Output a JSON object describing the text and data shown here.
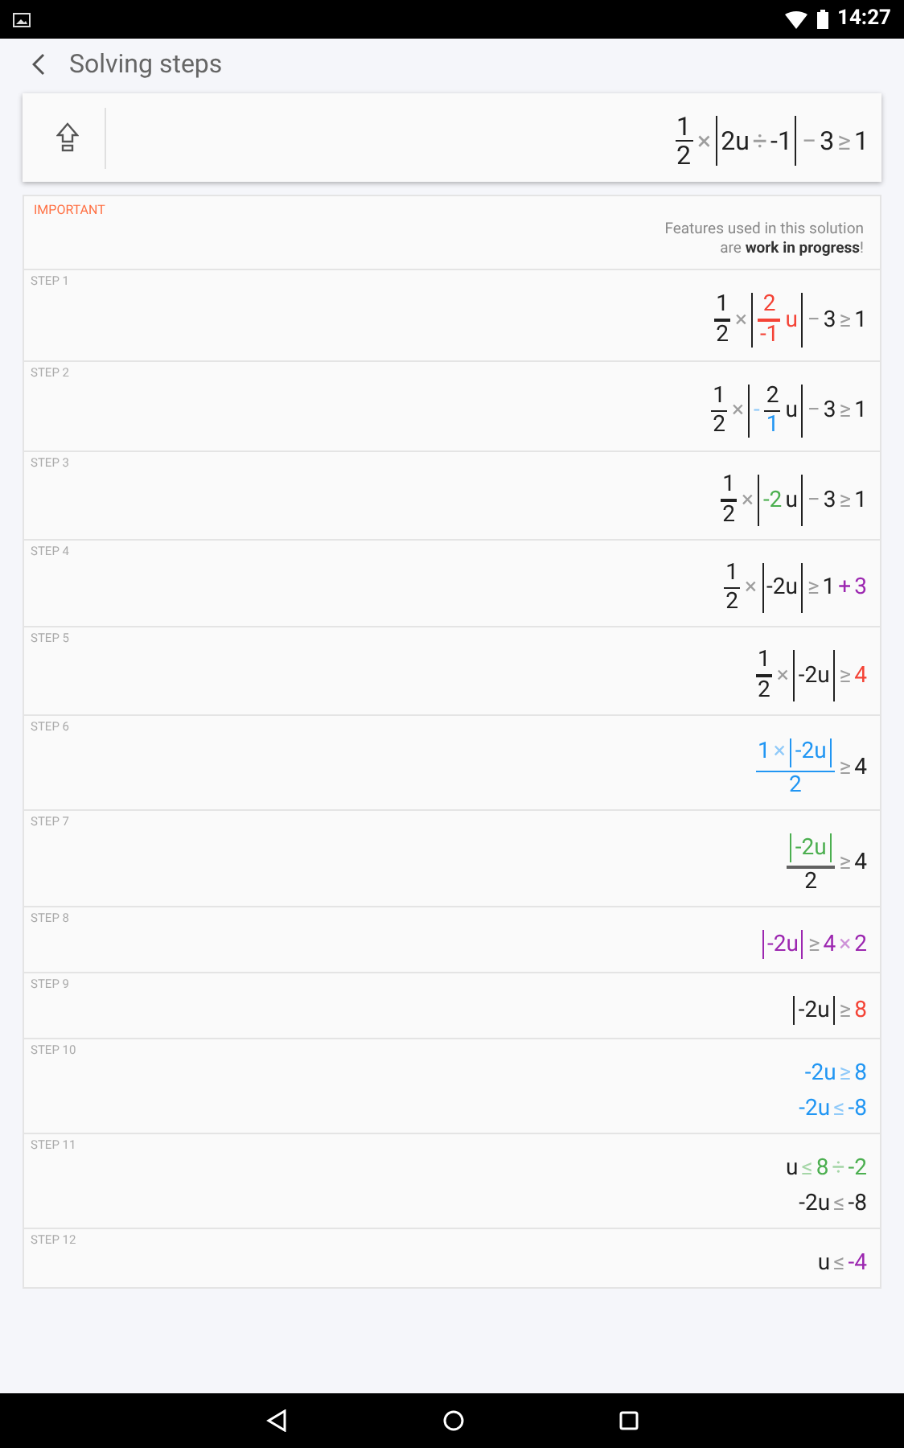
{
  "status_bar": {
    "time": "14:27"
  },
  "header": {
    "title": "Solving steps"
  },
  "input": {
    "expression": [
      {
        "kind": "frac",
        "num": [
          {
            "kind": "t",
            "text": "1",
            "color": "#212121"
          }
        ],
        "den": [
          {
            "kind": "t",
            "text": "2",
            "color": "#212121"
          }
        ],
        "color": "#212121"
      },
      {
        "kind": "t",
        "text": "×",
        "color": "#9e9e9e"
      },
      {
        "kind": "abs",
        "color": "#212121",
        "body": [
          {
            "kind": "t",
            "text": "2u",
            "color": "#212121"
          },
          {
            "kind": "t",
            "text": "÷",
            "color": "#9e9e9e"
          },
          {
            "kind": "t",
            "text": "-1",
            "color": "#212121"
          }
        ]
      },
      {
        "kind": "t",
        "text": "−",
        "color": "#9e9e9e"
      },
      {
        "kind": "t",
        "text": "3",
        "color": "#212121"
      },
      {
        "kind": "t",
        "text": "≥",
        "color": "#9e9e9e"
      },
      {
        "kind": "t",
        "text": "1",
        "color": "#212121"
      }
    ]
  },
  "notice": {
    "label": "IMPORTANT",
    "lines": [
      "Features used in this solution",
      "are **work in progress**!"
    ]
  },
  "steps": [
    {
      "label": "STEP 1",
      "lines": [
        [
          {
            "kind": "frac",
            "num": [
              {
                "kind": "t",
                "text": "1",
                "color": "#212121"
              }
            ],
            "den": [
              {
                "kind": "t",
                "text": "2",
                "color": "#212121"
              }
            ],
            "color": "#212121"
          },
          {
            "kind": "t",
            "text": "×",
            "color": "#9e9e9e"
          },
          {
            "kind": "abs",
            "color": "#212121",
            "body": [
              {
                "kind": "frac",
                "num": [
                  {
                    "kind": "t",
                    "text": "2",
                    "color": "#f44336"
                  }
                ],
                "den": [
                  {
                    "kind": "t",
                    "text": "-1",
                    "color": "#f44336"
                  }
                ],
                "color": "#f44336"
              },
              {
                "kind": "t",
                "text": "u",
                "color": "#f44336"
              }
            ]
          },
          {
            "kind": "t",
            "text": "−",
            "color": "#9e9e9e"
          },
          {
            "kind": "t",
            "text": "3",
            "color": "#212121"
          },
          {
            "kind": "t",
            "text": "≥",
            "color": "#9e9e9e"
          },
          {
            "kind": "t",
            "text": "1",
            "color": "#212121"
          }
        ]
      ]
    },
    {
      "label": "STEP 2",
      "lines": [
        [
          {
            "kind": "frac",
            "num": [
              {
                "kind": "t",
                "text": "1",
                "color": "#212121"
              }
            ],
            "den": [
              {
                "kind": "t",
                "text": "2",
                "color": "#212121"
              }
            ],
            "color": "#212121"
          },
          {
            "kind": "t",
            "text": "×",
            "color": "#9e9e9e"
          },
          {
            "kind": "abs",
            "color": "#212121",
            "body": [
              {
                "kind": "t",
                "text": "-",
                "color": "#90caf9"
              },
              {
                "kind": "frac",
                "num": [
                  {
                    "kind": "t",
                    "text": "2",
                    "color": "#212121"
                  }
                ],
                "den": [
                  {
                    "kind": "t",
                    "text": "1",
                    "color": "#2196f3"
                  }
                ],
                "color": "#212121"
              },
              {
                "kind": "t",
                "text": "u",
                "color": "#212121"
              }
            ]
          },
          {
            "kind": "t",
            "text": "−",
            "color": "#9e9e9e"
          },
          {
            "kind": "t",
            "text": "3",
            "color": "#212121"
          },
          {
            "kind": "t",
            "text": "≥",
            "color": "#9e9e9e"
          },
          {
            "kind": "t",
            "text": "1",
            "color": "#212121"
          }
        ]
      ]
    },
    {
      "label": "STEP 3",
      "lines": [
        [
          {
            "kind": "frac",
            "num": [
              {
                "kind": "t",
                "text": "1",
                "color": "#212121"
              }
            ],
            "den": [
              {
                "kind": "t",
                "text": "2",
                "color": "#212121"
              }
            ],
            "color": "#212121"
          },
          {
            "kind": "t",
            "text": "×",
            "color": "#9e9e9e"
          },
          {
            "kind": "abs",
            "color": "#212121",
            "body": [
              {
                "kind": "t",
                "text": "-2",
                "color": "#4caf50"
              },
              {
                "kind": "t",
                "text": "u",
                "color": "#212121"
              }
            ]
          },
          {
            "kind": "t",
            "text": "−",
            "color": "#9e9e9e"
          },
          {
            "kind": "t",
            "text": "3",
            "color": "#212121"
          },
          {
            "kind": "t",
            "text": "≥",
            "color": "#9e9e9e"
          },
          {
            "kind": "t",
            "text": "1",
            "color": "#212121"
          }
        ]
      ]
    },
    {
      "label": "STEP 4",
      "lines": [
        [
          {
            "kind": "frac",
            "num": [
              {
                "kind": "t",
                "text": "1",
                "color": "#212121"
              }
            ],
            "den": [
              {
                "kind": "t",
                "text": "2",
                "color": "#212121"
              }
            ],
            "color": "#212121"
          },
          {
            "kind": "t",
            "text": "×",
            "color": "#9e9e9e"
          },
          {
            "kind": "abs",
            "color": "#212121",
            "body": [
              {
                "kind": "t",
                "text": "-2u",
                "color": "#212121"
              }
            ]
          },
          {
            "kind": "t",
            "text": "≥",
            "color": "#9e9e9e"
          },
          {
            "kind": "t",
            "text": "1",
            "color": "#212121"
          },
          {
            "kind": "t",
            "text": "+",
            "color": "#9c27b0"
          },
          {
            "kind": "t",
            "text": "3",
            "color": "#9c27b0"
          }
        ]
      ]
    },
    {
      "label": "STEP 5",
      "lines": [
        [
          {
            "kind": "frac",
            "num": [
              {
                "kind": "t",
                "text": "1",
                "color": "#212121"
              }
            ],
            "den": [
              {
                "kind": "t",
                "text": "2",
                "color": "#212121"
              }
            ],
            "color": "#212121"
          },
          {
            "kind": "t",
            "text": "×",
            "color": "#9e9e9e"
          },
          {
            "kind": "abs",
            "color": "#212121",
            "body": [
              {
                "kind": "t",
                "text": "-2u",
                "color": "#212121"
              }
            ]
          },
          {
            "kind": "t",
            "text": "≥",
            "color": "#9e9e9e"
          },
          {
            "kind": "t",
            "text": "4",
            "color": "#f44336"
          }
        ]
      ]
    },
    {
      "label": "STEP 6",
      "lines": [
        [
          {
            "kind": "frac",
            "num": [
              {
                "kind": "t",
                "text": "1",
                "color": "#2196f3"
              },
              {
                "kind": "t",
                "text": "×",
                "color": "#90caf9"
              },
              {
                "kind": "abs",
                "color": "#2196f3",
                "body": [
                  {
                    "kind": "t",
                    "text": "-2u",
                    "color": "#2196f3"
                  }
                ]
              }
            ],
            "den": [
              {
                "kind": "t",
                "text": "2",
                "color": "#2196f3"
              }
            ],
            "color": "#2196f3"
          },
          {
            "kind": "t",
            "text": "≥",
            "color": "#9e9e9e"
          },
          {
            "kind": "t",
            "text": "4",
            "color": "#212121"
          }
        ]
      ]
    },
    {
      "label": "STEP 7",
      "lines": [
        [
          {
            "kind": "frac",
            "num": [
              {
                "kind": "abs",
                "color": "#4caf50",
                "body": [
                  {
                    "kind": "t",
                    "text": "-2u",
                    "color": "#4caf50"
                  }
                ]
              }
            ],
            "den": [
              {
                "kind": "t",
                "text": "2",
                "color": "#212121"
              }
            ],
            "color": "#616161"
          },
          {
            "kind": "t",
            "text": "≥",
            "color": "#9e9e9e"
          },
          {
            "kind": "t",
            "text": "4",
            "color": "#212121"
          }
        ]
      ]
    },
    {
      "label": "STEP 8",
      "lines": [
        [
          {
            "kind": "abs",
            "color": "#9c27b0",
            "body": [
              {
                "kind": "t",
                "text": "-2u",
                "color": "#9c27b0"
              }
            ]
          },
          {
            "kind": "t",
            "text": "≥",
            "color": "#9e9e9e"
          },
          {
            "kind": "t",
            "text": "4",
            "color": "#9c27b0"
          },
          {
            "kind": "t",
            "text": "×",
            "color": "#ce93d8"
          },
          {
            "kind": "t",
            "text": "2",
            "color": "#9c27b0"
          }
        ]
      ]
    },
    {
      "label": "STEP 9",
      "lines": [
        [
          {
            "kind": "abs",
            "color": "#212121",
            "body": [
              {
                "kind": "t",
                "text": "-2u",
                "color": "#212121"
              }
            ]
          },
          {
            "kind": "t",
            "text": "≥",
            "color": "#9e9e9e"
          },
          {
            "kind": "t",
            "text": "8",
            "color": "#f44336"
          }
        ]
      ]
    },
    {
      "label": "STEP 10",
      "lines": [
        [
          {
            "kind": "t",
            "text": "-2u",
            "color": "#2196f3"
          },
          {
            "kind": "t",
            "text": "≥",
            "color": "#90caf9"
          },
          {
            "kind": "t",
            "text": "8",
            "color": "#2196f3"
          }
        ],
        [
          {
            "kind": "t",
            "text": "-2u",
            "color": "#2196f3"
          },
          {
            "kind": "t",
            "text": "≤",
            "color": "#90caf9"
          },
          {
            "kind": "t",
            "text": "-8",
            "color": "#2196f3"
          }
        ]
      ]
    },
    {
      "label": "STEP 11",
      "lines": [
        [
          {
            "kind": "t",
            "text": "u",
            "color": "#212121"
          },
          {
            "kind": "t",
            "text": "≤",
            "color": "#a5d6a7"
          },
          {
            "kind": "t",
            "text": "8",
            "color": "#4caf50"
          },
          {
            "kind": "t",
            "text": "÷",
            "color": "#a5d6a7"
          },
          {
            "kind": "t",
            "text": "-2",
            "color": "#4caf50"
          }
        ],
        [
          {
            "kind": "t",
            "text": "-2u",
            "color": "#212121"
          },
          {
            "kind": "t",
            "text": "≤",
            "color": "#9e9e9e"
          },
          {
            "kind": "t",
            "text": "-8",
            "color": "#212121"
          }
        ]
      ]
    },
    {
      "label": "STEP 12",
      "lines": [
        [
          {
            "kind": "t",
            "text": "u",
            "color": "#212121"
          },
          {
            "kind": "t",
            "text": "≤",
            "color": "#9e9e9e"
          },
          {
            "kind": "t",
            "text": "-4",
            "color": "#9c27b0"
          }
        ]
      ]
    }
  ]
}
